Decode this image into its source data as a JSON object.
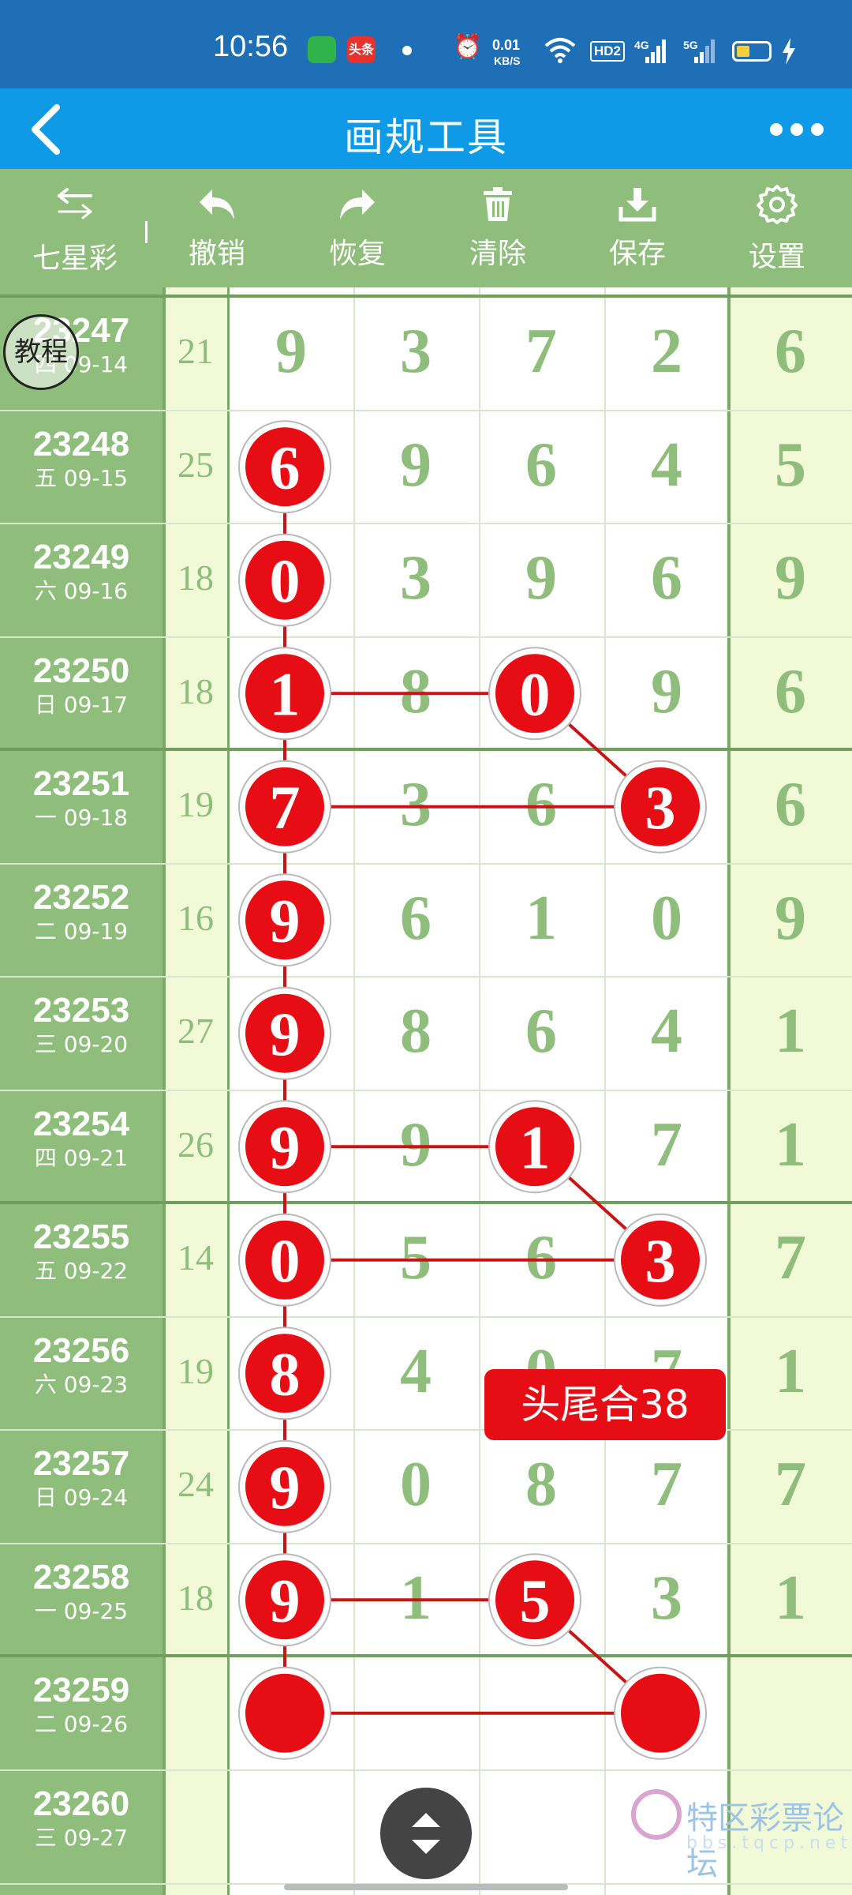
{
  "status_bar": {
    "time": "10:56",
    "net_speed_value": "0.01",
    "net_speed_unit": "KB/S",
    "hd_label": "HD2",
    "sig1_label": "4G",
    "sig2_label": "5G",
    "app_badge": "头条",
    "alarm_icon": "alarm-icon",
    "wifi_icon": "wifi-icon"
  },
  "title_bar": {
    "title": "画规工具"
  },
  "toolbar": {
    "mode_label": "七星彩",
    "undo_label": "撤销",
    "redo_label": "恢复",
    "clear_label": "清除",
    "save_label": "保存",
    "settings_label": "设置"
  },
  "grid": {
    "tutorial_badge": "教程",
    "rows": [
      {
        "period": "23247",
        "date": "四 09-14",
        "sum": "21",
        "digits": [
          "9",
          "3",
          "7",
          "2"
        ],
        "last": "6"
      },
      {
        "period": "23248",
        "date": "五 09-15",
        "sum": "25",
        "digits": [
          "6",
          "9",
          "6",
          "4"
        ],
        "last": "5"
      },
      {
        "period": "23249",
        "date": "六 09-16",
        "sum": "18",
        "digits": [
          "0",
          "3",
          "9",
          "6"
        ],
        "last": "9"
      },
      {
        "period": "23250",
        "date": "日 09-17",
        "sum": "18",
        "digits": [
          "1",
          "8",
          "0",
          "9"
        ],
        "last": "6"
      },
      {
        "period": "23251",
        "date": "一 09-18",
        "sum": "19",
        "digits": [
          "7",
          "3",
          "6",
          "3"
        ],
        "last": "6"
      },
      {
        "period": "23252",
        "date": "二 09-19",
        "sum": "16",
        "digits": [
          "9",
          "6",
          "1",
          "0"
        ],
        "last": "9"
      },
      {
        "period": "23253",
        "date": "三 09-20",
        "sum": "27",
        "digits": [
          "9",
          "8",
          "6",
          "4"
        ],
        "last": "1"
      },
      {
        "period": "23254",
        "date": "四 09-21",
        "sum": "26",
        "digits": [
          "9",
          "9",
          "1",
          "7"
        ],
        "last": "1"
      },
      {
        "period": "23255",
        "date": "五 09-22",
        "sum": "14",
        "digits": [
          "0",
          "5",
          "6",
          "3"
        ],
        "last": "7"
      },
      {
        "period": "23256",
        "date": "六 09-23",
        "sum": "19",
        "digits": [
          "8",
          "4",
          "0",
          "7"
        ],
        "last": "1"
      },
      {
        "period": "23257",
        "date": "日 09-24",
        "sum": "24",
        "digits": [
          "9",
          "0",
          "8",
          "7"
        ],
        "last": "7"
      },
      {
        "period": "23258",
        "date": "一 09-25",
        "sum": "18",
        "digits": [
          "9",
          "1",
          "5",
          "3"
        ],
        "last": "1"
      },
      {
        "period": "23259",
        "date": "二 09-26",
        "sum": "",
        "digits": [
          "",
          "",
          "",
          ""
        ],
        "last": ""
      },
      {
        "period": "23260",
        "date": "三 09-27",
        "sum": "",
        "digits": [
          "",
          "",
          "",
          ""
        ],
        "last": ""
      }
    ],
    "marks": [
      {
        "row": 1,
        "col": 0
      },
      {
        "row": 2,
        "col": 0
      },
      {
        "row": 3,
        "col": 0
      },
      {
        "row": 3,
        "col": 2
      },
      {
        "row": 4,
        "col": 0
      },
      {
        "row": 4,
        "col": 3
      },
      {
        "row": 5,
        "col": 0
      },
      {
        "row": 6,
        "col": 0
      },
      {
        "row": 7,
        "col": 0
      },
      {
        "row": 7,
        "col": 2
      },
      {
        "row": 8,
        "col": 0
      },
      {
        "row": 8,
        "col": 3
      },
      {
        "row": 9,
        "col": 0
      },
      {
        "row": 10,
        "col": 0
      },
      {
        "row": 11,
        "col": 0
      },
      {
        "row": 11,
        "col": 2
      },
      {
        "row": 12,
        "col": 0
      },
      {
        "row": 12,
        "col": 3
      }
    ],
    "lines": [
      [
        [
          1,
          0
        ],
        [
          2,
          0
        ]
      ],
      [
        [
          2,
          0
        ],
        [
          3,
          0
        ]
      ],
      [
        [
          3,
          0
        ],
        [
          4,
          0
        ]
      ],
      [
        [
          4,
          0
        ],
        [
          5,
          0
        ]
      ],
      [
        [
          5,
          0
        ],
        [
          6,
          0
        ]
      ],
      [
        [
          6,
          0
        ],
        [
          7,
          0
        ]
      ],
      [
        [
          7,
          0
        ],
        [
          8,
          0
        ]
      ],
      [
        [
          8,
          0
        ],
        [
          9,
          0
        ]
      ],
      [
        [
          9,
          0
        ],
        [
          10,
          0
        ]
      ],
      [
        [
          10,
          0
        ],
        [
          11,
          0
        ]
      ],
      [
        [
          11,
          0
        ],
        [
          12,
          0
        ]
      ],
      [
        [
          3,
          0
        ],
        [
          3,
          2
        ]
      ],
      [
        [
          3,
          2
        ],
        [
          4,
          3
        ]
      ],
      [
        [
          4,
          0
        ],
        [
          4,
          3
        ]
      ],
      [
        [
          7,
          0
        ],
        [
          7,
          2
        ]
      ],
      [
        [
          7,
          2
        ],
        [
          8,
          3
        ]
      ],
      [
        [
          8,
          0
        ],
        [
          8,
          3
        ]
      ],
      [
        [
          11,
          0
        ],
        [
          11,
          2
        ]
      ],
      [
        [
          11,
          2
        ],
        [
          12,
          3
        ]
      ],
      [
        [
          12,
          0
        ],
        [
          12,
          3
        ]
      ]
    ],
    "tag_label": "头尾合38",
    "mark_color": "#e60e14",
    "line_color": "#c81414"
  },
  "watermark": {
    "text": "特区彩票论坛",
    "sub": "bbs.tqcp.net"
  }
}
